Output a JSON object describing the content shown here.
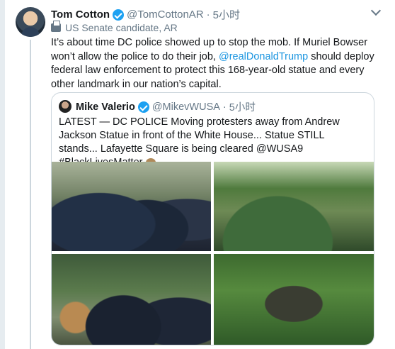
{
  "tweet": {
    "author_name": "Tom Cotton",
    "author_handle": "@TomCottonAR",
    "time": "5小时",
    "label": "US Senate candidate, AR",
    "text_part1": "It’s about time DC police showed up to stop the mob. If Muriel Bowser won’t allow the police to do their job, ",
    "mention": "@realDonaldTrump",
    "text_part2": " should deploy federal law enforcement to protect this 168-year-old statue and every other landmark in our nation’s capital."
  },
  "quote": {
    "author_name": "Mike Valerio",
    "author_handle": "@MikevWUSA",
    "time": "5小时",
    "text": "LATEST — DC POLICE Moving protesters away from Andrew Jackson Statue in front of the White House... Statue STILL stands... Lafayette Square is being cleared @WUSA9 #BlackLivesMatter"
  },
  "icons": {
    "verified": "verified-badge-icon",
    "label": "ballot-box-icon",
    "menu": "chevron-down-icon",
    "emoji": "beer-mug-emoji"
  },
  "colors": {
    "link": "#1b95e0",
    "verified": "#1da1f2",
    "secondary_text": "#657786"
  }
}
